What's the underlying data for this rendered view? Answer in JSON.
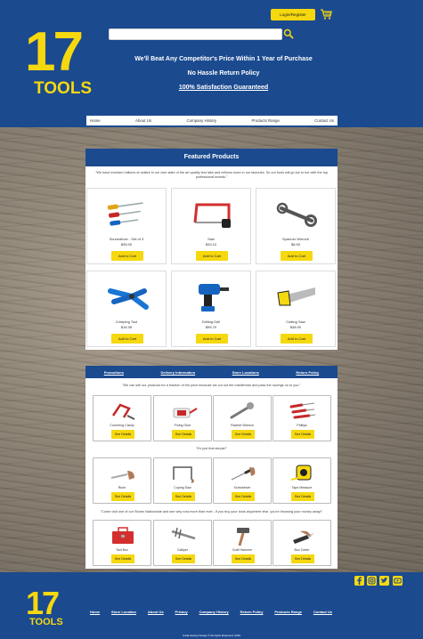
{
  "header": {
    "login_label": "Login/Register",
    "search_placeholder": "",
    "taglines": [
      "We'll Beat Any Competitor's Price Within 1 Year of Purchase",
      "No Hassle Return Policy",
      "100% Satisfaction Guaranteed"
    ],
    "logo_number": "17",
    "logo_word": "TOOLS"
  },
  "nav": [
    "Home",
    "About Us",
    "Company History",
    "Products Range",
    "Contact Us"
  ],
  "featured": {
    "title": "Featured Products",
    "quote": "\"We have invested millions of dollars in our own state of the art quality test labs and millions more in our factories. So our tools will go toe to toe with the top professional brands.\"",
    "button_label": "Add to Cart",
    "items": [
      {
        "name": "Screwdriver - Set of 3",
        "price": "$35.00",
        "icon": "screwdriver-set-icon"
      },
      {
        "name": "Saw",
        "price": "$33.10",
        "icon": "hacksaw-icon"
      },
      {
        "name": "Spanner Wrench",
        "price": "$8.50",
        "icon": "wrench-icon"
      },
      {
        "name": "Crimping Tool",
        "price": "$16.35",
        "icon": "crimping-tool-icon"
      },
      {
        "name": "Drilling Drill",
        "price": "$95.70",
        "icon": "drill-icon"
      },
      {
        "name": "Cutting Saw",
        "price": "$48.90",
        "icon": "cutting-saw-icon"
      }
    ]
  },
  "tabs": [
    "Promotions",
    "Delivery Information",
    "Store Locations",
    "Return Policy"
  ],
  "promotions": {
    "quote1": "\"We can sell our products for a fraction of the price because we cut out the middleman and pass the savings on to you.\"",
    "quote2": "\"It's just that simple!\"",
    "quote3": "\"Come visit one of our Stores Nationwide and see why now more than ever...If you buy your tools anywhere else, you're throwing your money away!\"",
    "button_label": "See Details",
    "items": [
      {
        "name": "Cornering Clamp",
        "icon": "clamp-icon"
      },
      {
        "name": "Fixing Glue",
        "icon": "glue-icon"
      },
      {
        "name": "Ratchet Wrench",
        "icon": "ratchet-icon"
      },
      {
        "name": "Phillips",
        "icon": "phillips-icon"
      },
      {
        "name": "Ruler",
        "icon": "ruler-icon"
      },
      {
        "name": "Coping Saw",
        "icon": "coping-saw-icon"
      },
      {
        "name": "Screwdriver",
        "icon": "screwdriver-icon"
      },
      {
        "name": "Tape Measure",
        "icon": "tape-measure-icon"
      },
      {
        "name": "Tool Box",
        "icon": "toolbox-icon"
      },
      {
        "name": "Calliper",
        "icon": "calliper-icon"
      },
      {
        "name": "Craft Hammer",
        "icon": "hammer-icon"
      },
      {
        "name": "Box Cutter",
        "icon": "box-cutter-icon"
      }
    ]
  },
  "footer": {
    "links": [
      "Home",
      "Store Location",
      "About Us",
      "Privacy",
      "Company History",
      "Return Policy",
      "Products Range",
      "Contact Us"
    ],
    "copyright": "Carla Harvey Design  © All rights Reserved, 2019",
    "social_icons": [
      "facebook-icon",
      "instagram-icon",
      "twitter-icon",
      "youtube-icon"
    ]
  },
  "colors": {
    "primary": "#1b4a8f",
    "accent": "#f6d80f"
  }
}
